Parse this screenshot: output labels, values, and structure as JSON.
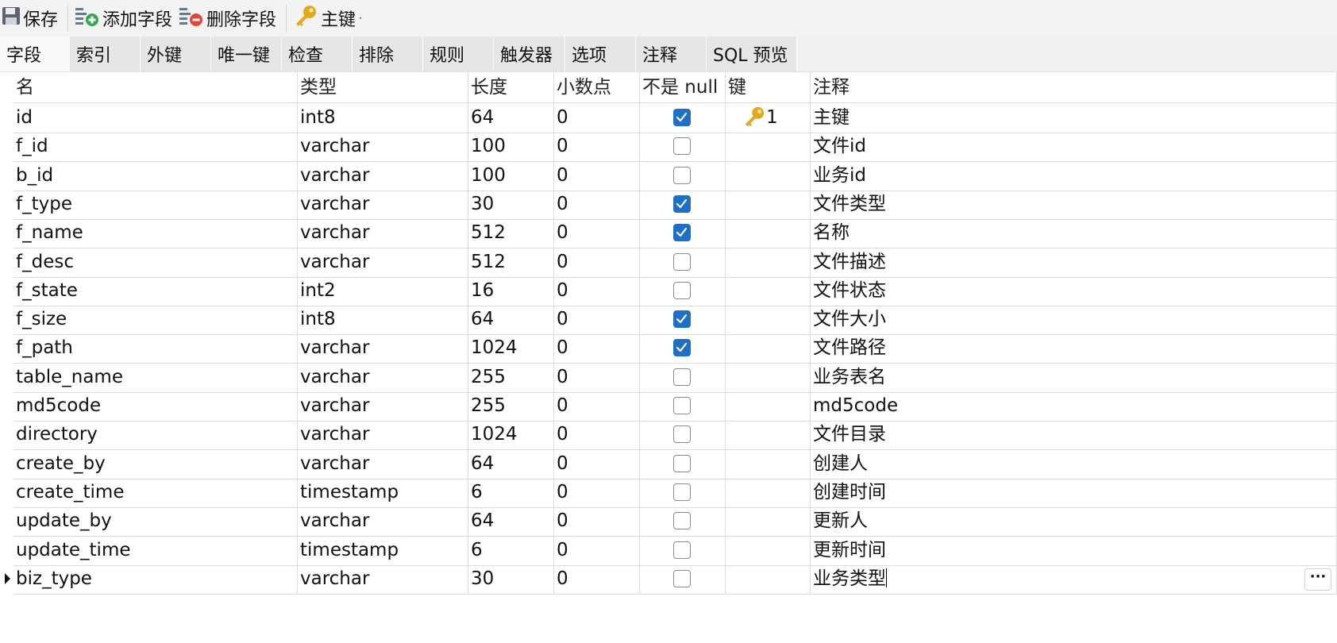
{
  "toolbar": {
    "save_label": "保存",
    "add_field_label": "添加字段",
    "delete_field_label": "删除字段",
    "primary_key_label": "主键"
  },
  "tabs": [
    "字段",
    "索引",
    "外键",
    "唯一键",
    "检查",
    "排除",
    "规则",
    "触发器",
    "选项",
    "注释",
    "SQL 预览"
  ],
  "active_tab": "字段",
  "columns": [
    "名",
    "类型",
    "长度",
    "小数点",
    "不是 null",
    "键",
    "注释"
  ],
  "rows": [
    {
      "name": "id",
      "type": "int8",
      "length": "64",
      "decimals": "0",
      "not_null": true,
      "key": "1",
      "comment": "主键"
    },
    {
      "name": "f_id",
      "type": "varchar",
      "length": "100",
      "decimals": "0",
      "not_null": false,
      "key": "",
      "comment": "文件id"
    },
    {
      "name": "b_id",
      "type": "varchar",
      "length": "100",
      "decimals": "0",
      "not_null": false,
      "key": "",
      "comment": "业务id"
    },
    {
      "name": "f_type",
      "type": "varchar",
      "length": "30",
      "decimals": "0",
      "not_null": true,
      "key": "",
      "comment": "文件类型"
    },
    {
      "name": "f_name",
      "type": "varchar",
      "length": "512",
      "decimals": "0",
      "not_null": true,
      "key": "",
      "comment": "名称"
    },
    {
      "name": "f_desc",
      "type": "varchar",
      "length": "512",
      "decimals": "0",
      "not_null": false,
      "key": "",
      "comment": "文件描述"
    },
    {
      "name": "f_state",
      "type": "int2",
      "length": "16",
      "decimals": "0",
      "not_null": false,
      "key": "",
      "comment": "文件状态"
    },
    {
      "name": "f_size",
      "type": "int8",
      "length": "64",
      "decimals": "0",
      "not_null": true,
      "key": "",
      "comment": "文件大小"
    },
    {
      "name": "f_path",
      "type": "varchar",
      "length": "1024",
      "decimals": "0",
      "not_null": true,
      "key": "",
      "comment": "文件路径"
    },
    {
      "name": "table_name",
      "type": "varchar",
      "length": "255",
      "decimals": "0",
      "not_null": false,
      "key": "",
      "comment": "业务表名"
    },
    {
      "name": "md5code",
      "type": "varchar",
      "length": "255",
      "decimals": "0",
      "not_null": false,
      "key": "",
      "comment": "md5code"
    },
    {
      "name": "directory",
      "type": "varchar",
      "length": "1024",
      "decimals": "0",
      "not_null": false,
      "key": "",
      "comment": "文件目录"
    },
    {
      "name": "create_by",
      "type": "varchar",
      "length": "64",
      "decimals": "0",
      "not_null": false,
      "key": "",
      "comment": "创建人"
    },
    {
      "name": "create_time",
      "type": "timestamp",
      "length": "6",
      "decimals": "0",
      "not_null": false,
      "key": "",
      "comment": "创建时间"
    },
    {
      "name": "update_by",
      "type": "varchar",
      "length": "64",
      "decimals": "0",
      "not_null": false,
      "key": "",
      "comment": "更新人"
    },
    {
      "name": "update_time",
      "type": "timestamp",
      "length": "6",
      "decimals": "0",
      "not_null": false,
      "key": "",
      "comment": "更新时间"
    },
    {
      "name": "biz_type",
      "type": "varchar",
      "length": "30",
      "decimals": "0",
      "not_null": false,
      "key": "",
      "comment": "业务类型"
    }
  ],
  "current_row": "biz_type",
  "more_button_label": "···",
  "colors": {
    "checkbox_on": "#1e6fc5",
    "key_icon": "#e3a91a",
    "add_icon": "#2fa84f",
    "delete_icon": "#e2453c"
  }
}
